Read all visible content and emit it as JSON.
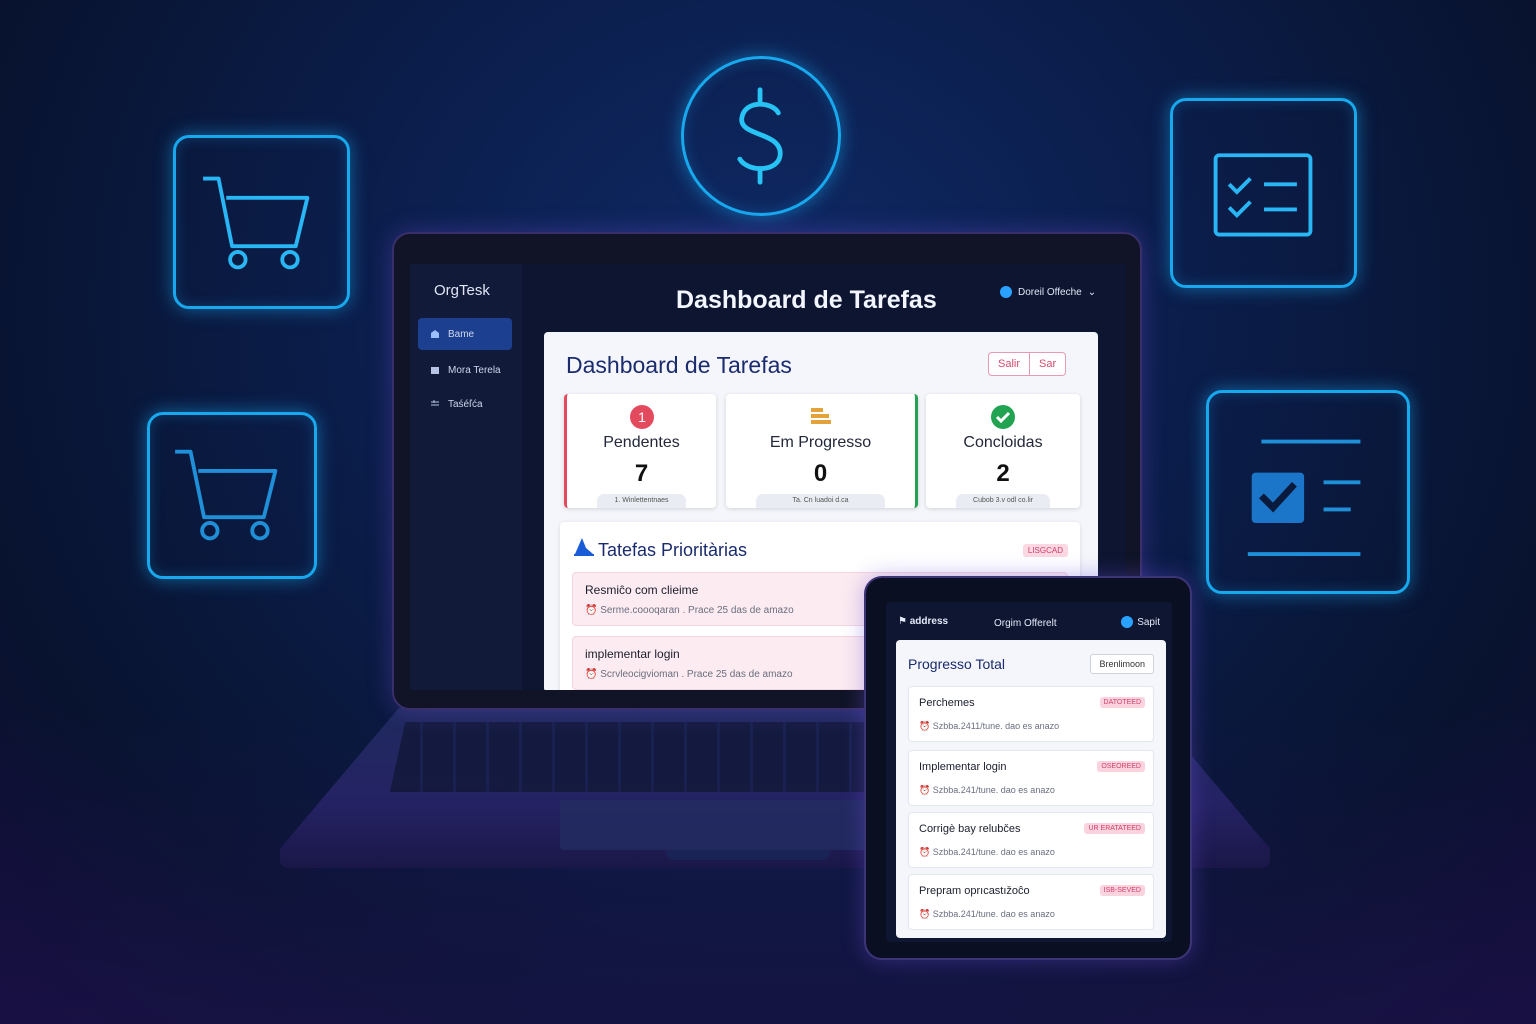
{
  "decor": {
    "cart_icon": "shopping-cart-icon",
    "dollar_icon": "dollar-icon",
    "checklist_icon": "checklist-icon",
    "checkbox_icon": "checkbox-icon",
    "accent": "#18a8ee"
  },
  "laptop": {
    "brand": "OrgTesk",
    "sidebar": {
      "items": [
        {
          "label": "Bame",
          "active": true
        },
        {
          "label": "Mora Terela",
          "active": false
        },
        {
          "label": "Taśéľća",
          "active": false
        }
      ]
    },
    "header": {
      "title": "Dashboard de Tarefas",
      "user": "Doreil Offeche"
    },
    "panel": {
      "title": "Dashboard de Tarefas",
      "buttons": [
        "Salir",
        "Sar"
      ]
    },
    "stats": [
      {
        "label": "Pendentes",
        "value": "7",
        "foot": "1. Winlettentnaes",
        "accent": "#e34a5e",
        "icon": "alert-number-icon"
      },
      {
        "label": "Em Progresso",
        "value": "0",
        "foot": "Ta. Cn luadoi  d.ca",
        "accent": "#e3a33a",
        "icon": "stack-icon"
      },
      {
        "label": "Concloidas",
        "value": "2",
        "foot": "Cubob 3.v odl co.lir",
        "accent": "#22a352",
        "icon": "check-circle-icon"
      }
    ],
    "priority": {
      "title": "Tatefas Prioritàrias",
      "tag": "LISGCAD",
      "tasks": [
        {
          "title": "Resmiĉo com clieime",
          "meta": "Serme.coooqaran . Prace 25 das de amazo"
        },
        {
          "title": "implementar login",
          "meta": "Scrvleocigvioman . Prace 25 das de amazo"
        }
      ]
    }
  },
  "tablet": {
    "header": {
      "left": "address",
      "center": "Orgim Offerelt",
      "right": "Sapit"
    },
    "panel": {
      "title": "Progresso Total",
      "button": "Brenlimoon",
      "tasks": [
        {
          "title": "Perchemes",
          "meta": "Szbba.2411/tune. dao es anazo",
          "badge": "DATOTEED"
        },
        {
          "title": "Implementar login",
          "meta": "Szbba.241/tune. dao es anazo",
          "badge": "OSEOREED"
        },
        {
          "title": "Corrigè bay relubčes",
          "meta": "Szbba.241/tune. dao es anazo",
          "badge": "UR ERATATEED"
        },
        {
          "title": "Prepram oprıcastıžoĉo",
          "meta": "Szbba.241/tune. dao es anazo",
          "badge": "ISB-SEVED"
        }
      ]
    }
  }
}
